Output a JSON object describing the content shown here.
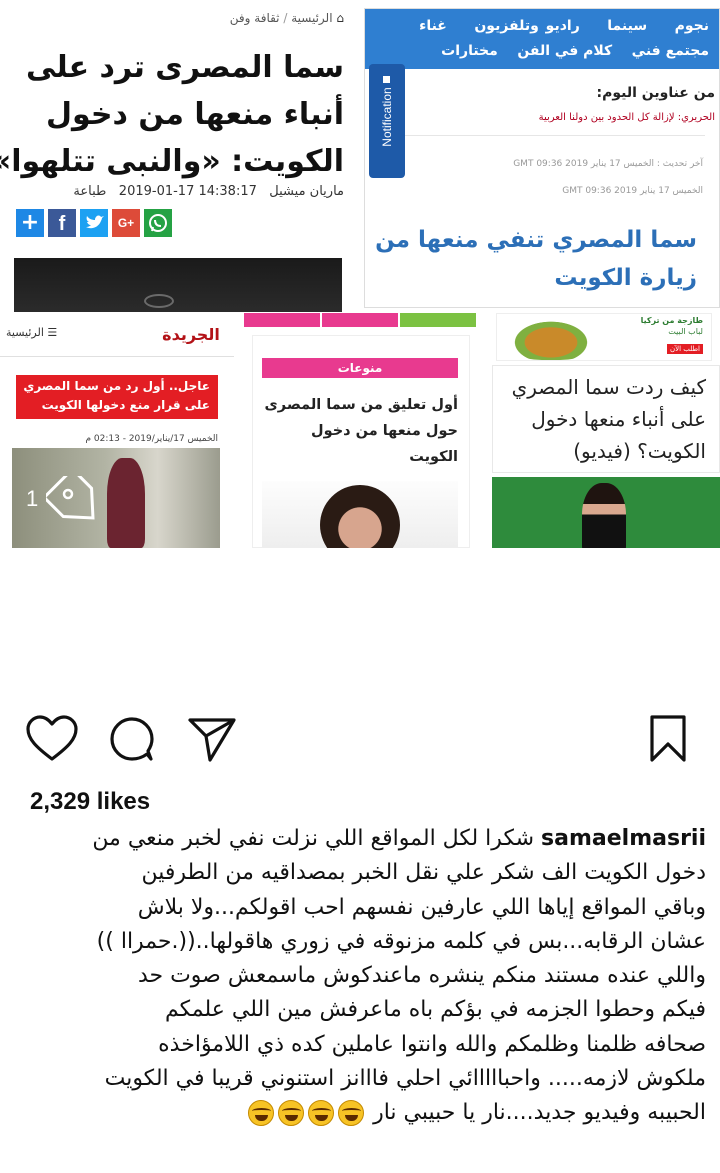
{
  "collage": {
    "card1": {
      "breadcrumb_home": "الرئيسية",
      "breadcrumb_section": "ثقافة وفن",
      "headline_l1": "سما المصرى ترد على",
      "headline_l2": "أنباء منعها من دخول",
      "headline_l3": "الكويت: «والنبى تتلهوا»",
      "author": "ماريان ميشيل",
      "datetime": "2019-01-17 14:38:17",
      "print_label": "طباعة"
    },
    "card2": {
      "nav_row1": [
        "نجوم",
        "سينما",
        "راديو وتلفزيون",
        "غناء"
      ],
      "nav_row2": [
        "مجتمع فني",
        "كلام في الفن",
        "مختارات"
      ],
      "notification_tab": "Notification",
      "today_label": "من عناوين اليوم:",
      "ticker": "الحريري: لإزالة كل الحدود بين دولنا العربية",
      "updated": "آخر تحديث : الخميس 17 يناير 2019 09:36 GMT",
      "date2": "الخميس 17 يناير 2019 09:36 GMT",
      "headline_l1": "سما المصري تنفي منعها من",
      "headline_l2": "زيارة الكويت"
    },
    "card3": {
      "menu_label": "الرئيسية",
      "logo_text": "الجريدة",
      "breaking_l1": "عاجل.. أول رد من سما المصري",
      "breaking_l2": "على قرار منع دخولها الكويت",
      "date": "الخميس 17/يناير/2019 - 02:13 م",
      "count": "1"
    },
    "card4": {
      "category": "منوعات",
      "headline_l1": "أول تعليق من سما المصرى",
      "headline_l2": "حول منعها من دخول",
      "headline_l3": "الكويت"
    },
    "card5": {
      "ad_text_l1": "طازجة من تركيا",
      "ad_text_l2": "لباب البيت",
      "ad_button": "اطلب الآن",
      "headline_l1": "كيف ردت سما المصري",
      "headline_l2": "على أنباء منعها دخول",
      "headline_l3": "الكويت؟ (فيديو)"
    }
  },
  "actions": {
    "like_icon": "heart-icon",
    "comment_icon": "comment-icon",
    "share_icon": "send-icon",
    "save_icon": "bookmark-icon"
  },
  "likes": "2,329 likes",
  "caption": {
    "username": "samaelmasrii",
    "line1": "شكرا لكل المواقع اللي نزلت نفي لخبر منعي من",
    "line2": "دخول الكويت الف شكر علي نقل الخبر بمصداقيه من الطرفين",
    "line3": "وباقي المواقع إياها اللي عارفين نفسهم احب اقولكم...ولا بلاش",
    "line4": "عشان الرقابه...بس في كلمه مزنوقه في زوري هاقولها..((.حمراا ))",
    "line5": "واللي عنده مستند منكم ينشره ماعندكوش ماسمعش صوت حد",
    "line6": "فيكم وحطوا الجزمه في بؤكم باه ماعرفش مين اللي علمكم",
    "line7": "صحافه ظلمنا وظلمكم والله وانتوا عاملين كده ذي اللامؤاخذه",
    "line8": "ملكوش لازمه..... واحبااااائي احلي فااانز استنوني قريبا في الكويت",
    "line9": "الحبيبه وفيديو جديد....نار يا حبيبي نار"
  },
  "colors": {
    "blue_nav": "#2f7fd1",
    "pink": "#e83a8f",
    "red": "#e31e24",
    "green": "#2e8b3c",
    "share_blue": "#1e88e5"
  }
}
